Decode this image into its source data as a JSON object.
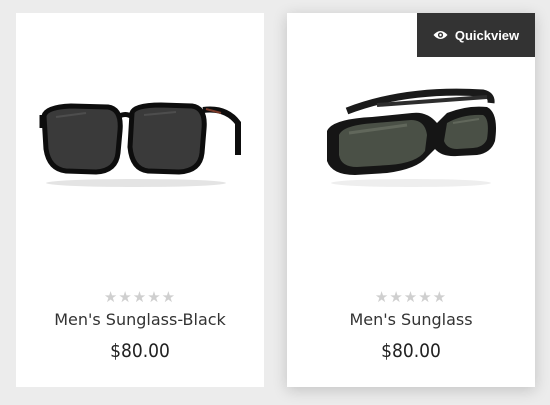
{
  "products": [
    {
      "name": "Men's Sunglass-Black",
      "price": "$80.00",
      "rating_stars": "★★★★★",
      "rating": 0,
      "image_icon": "sunglasses-black-image"
    },
    {
      "name": "Men's Sunglass",
      "price": "$80.00",
      "rating_stars": "★★★★★",
      "rating": 0,
      "image_icon": "sunglasses-wrap-image"
    }
  ],
  "quickview": {
    "label": "Quickview",
    "icon": "eye-icon"
  },
  "colors": {
    "background": "#ececec",
    "card": "#ffffff",
    "quickview_bg": "#333333",
    "star_empty": "#cfcfcf",
    "text": "#333333"
  }
}
